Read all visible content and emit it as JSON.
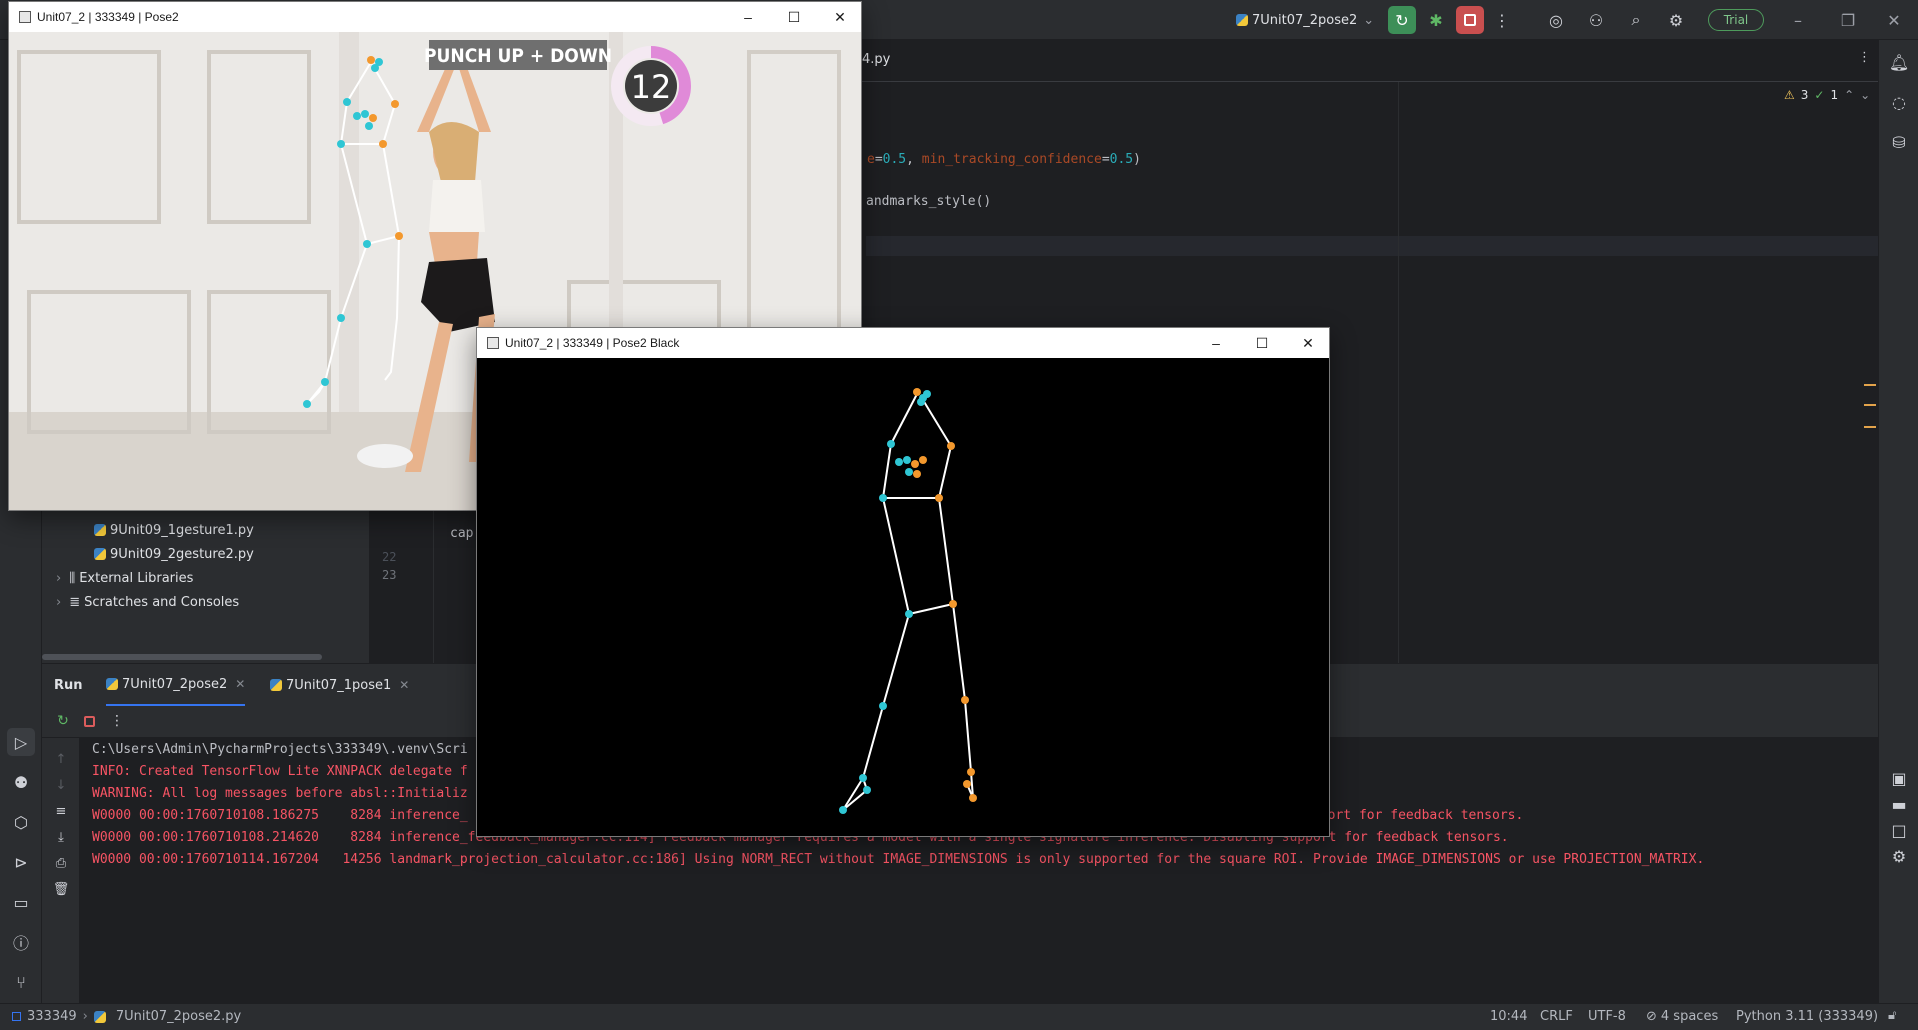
{
  "ide": {
    "run_config": "7Unit07_2pose2",
    "trial_label": "Trial",
    "editor_tab_fragment": "4.py",
    "inspection_warnings": "3",
    "inspection_checks": "1",
    "code_lines": [
      {
        "pre": "",
        "kw": "e",
        "eq": "=",
        "num": "0.5",
        "mid": ", ",
        "kw2": "min_tracking_confidence",
        "eq2": "=",
        "num2": "0.5",
        "post": ")"
      },
      {
        "text": "andmarks_style()"
      }
    ],
    "gutter_line_23": "23",
    "gutter_line_22": "22",
    "code_line_23": "cap.r",
    "project_tree": {
      "items": [
        {
          "label": "9Unit09_1gesture1.py",
          "type": "py"
        },
        {
          "label": "9Unit09_2gesture2.py",
          "type": "py"
        },
        {
          "label": "External Libraries",
          "type": "lib"
        },
        {
          "label": "Scratches and Consoles",
          "type": "scratch"
        }
      ]
    },
    "run_panel": {
      "title": "Run",
      "tabs": [
        "7Unit07_2pose2",
        "7Unit07_1pose1"
      ],
      "console": [
        {
          "text": "C:\\Users\\Admin\\PycharmProjects\\333349\\.venv\\Scri",
          "kind": "cmd"
        },
        {
          "text": "INFO: Created TensorFlow Lite XNNPACK delegate f",
          "kind": "err"
        },
        {
          "text": "WARNING: All log messages before absl::Initializ",
          "kind": "err"
        },
        {
          "text": "W0000 00:00:1760710108.186275    8284 inference_",
          "tail": "pport for feedback tensors.",
          "kind": "err"
        },
        {
          "text": "W0000 00:00:1760710108.214620    8284 inference_feedback_manager.cc:114] Feedback manager requires a model with a single signature inference. Disabling support for feedback tensors.",
          "kind": "err"
        },
        {
          "text": "W0000 00:00:1760710114.167204   14256 landmark_projection_calculator.cc:186] Using NORM_RECT without IMAGE_DIMENSIONS is only supported for the square ROI. Provide IMAGE_DIMENSIONS or use PROJECTION_MATRIX.",
          "kind": "err"
        }
      ]
    },
    "status_bar": {
      "project": "333349",
      "file": "7Unit07_2pose2.py",
      "position": "10:44",
      "line_sep": "CRLF",
      "encoding": "UTF-8",
      "indent": "4 spaces",
      "interpreter": "Python 3.11 (333349)"
    }
  },
  "window_pose2": {
    "title": "Unit07_2 | 333349 | Pose2",
    "banner": "PUNCH UP + DOWN",
    "counter": "12",
    "counter_progress": 0.45
  },
  "window_pose2_black": {
    "title": "Unit07_2 | 333349 | Pose2 Black"
  },
  "colors": {
    "landmark_left": "#2fc6d4",
    "landmark_right": "#f3982d",
    "skeleton": "#ffffff",
    "counter_ring": "#e08ad8",
    "error_text": "#f75464",
    "run_green": "#3d8f58",
    "stop_red": "#c94f4f"
  }
}
